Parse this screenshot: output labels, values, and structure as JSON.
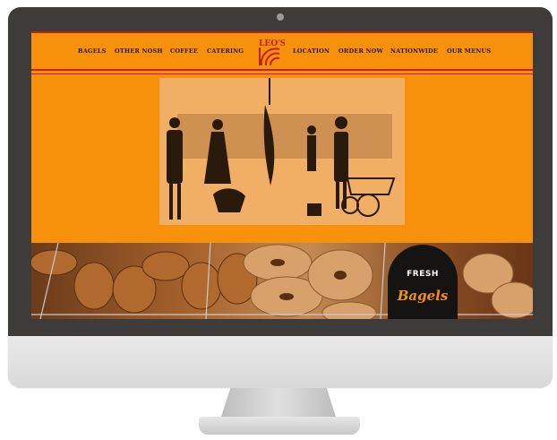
{
  "nav": {
    "items_left": [
      "BAGELS",
      "OTHER NOSH",
      "COFFEE",
      "CATERING"
    ],
    "items_right": [
      "LOCATION",
      "ORDER NOW",
      "NATIONWIDE",
      "OUR MENUS"
    ]
  },
  "logo": {
    "text": "LEO'S"
  },
  "badge": {
    "line1": "FRESH",
    "line2": "Bagels"
  },
  "colors": {
    "brand_orange": "#f7900a",
    "rule_red": "#c0201a",
    "bezel": "#3e3c3a",
    "badge_bg": "#161412"
  }
}
